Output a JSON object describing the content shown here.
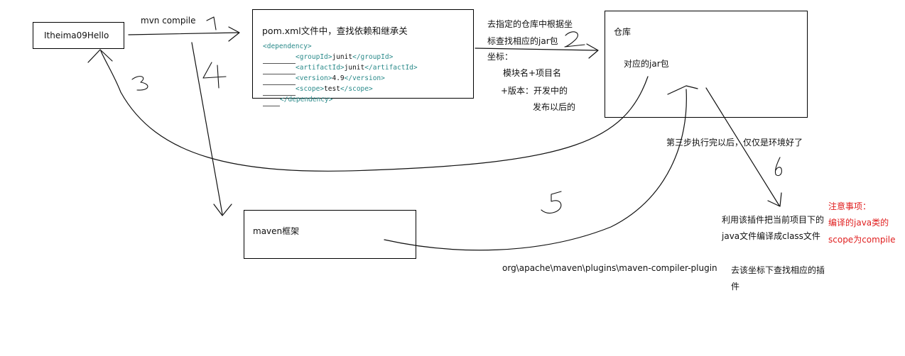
{
  "hello_box": {
    "label": "Itheima09Hello"
  },
  "command": {
    "label": "mvn compile"
  },
  "pom_box": {
    "title": "pom.xml文件中，查找依赖和继承关",
    "code": {
      "open": "<dependency>",
      "group_open": "<groupId>",
      "group_val": "junit",
      "group_close": "</groupId>",
      "artifact_open": "<artifactId>",
      "artifact_val": "junit",
      "artifact_close": "</artifactId>",
      "version_open": "<version>",
      "version_val": "4.9",
      "version_close": "</version>",
      "scope_open": "<scope>",
      "scope_val": "test",
      "scope_close": "</scope>",
      "close": "</dependency>"
    }
  },
  "repo_note": {
    "line1": "去指定的仓库中根据坐",
    "line2": "标查找相应的jar包",
    "line3": "坐标：",
    "line4": "模块名+项目名",
    "line5": "+版本：开发中的",
    "line6": "发布以后的"
  },
  "repo_box": {
    "title": "仓库",
    "jar": "对应的jar包"
  },
  "step3_note": "第三步执行完以后，仅仅是环境好了",
  "maven_box": {
    "label": "maven框架"
  },
  "plugin_note": {
    "line1": "利用该插件把当前项目下的",
    "line2": "java文件编译成class文件"
  },
  "warning": {
    "title": "注意事项：",
    "line1": "编译的java类的",
    "line2": "scope为compile"
  },
  "plugin_path": "org\\apache\\maven\\plugins\\maven-compiler-plugin",
  "find_plugin": {
    "line1": "去该坐标下查找相应的插",
    "line2": "件"
  },
  "step_numbers": {
    "s1": "1",
    "s2": "2",
    "s3": "3",
    "s4": "4",
    "s5": "5"
  },
  "colors": {
    "xml_tag": "#2a8a8a",
    "warning": "#e02020",
    "ink": "#111111"
  }
}
